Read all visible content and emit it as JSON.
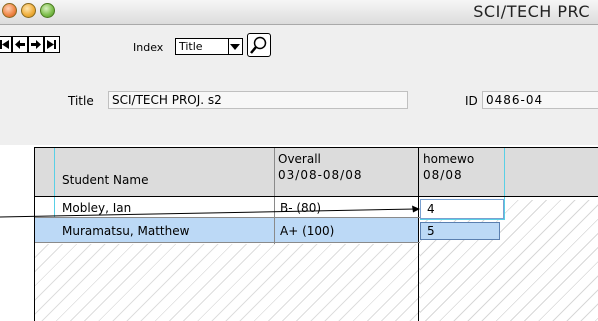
{
  "window": {
    "title": "SCI/TECH PRC"
  },
  "toolbar": {
    "index_label": "Index",
    "index_value": "Title",
    "nav_buttons": [
      "first-record",
      "previous-record",
      "next-record",
      "last-record"
    ]
  },
  "record": {
    "title_label": "Title",
    "title_value": "SCI/TECH PROJ. s2",
    "id_label": "ID",
    "id_value": "0486-04"
  },
  "table": {
    "columns": [
      {
        "line1": "",
        "line2": "Student Name"
      },
      {
        "line1": "Overall",
        "line2": "03/08-08/08"
      },
      {
        "line1": "homewo",
        "line2": "08/08"
      }
    ],
    "rows": [
      {
        "name": "Mobley, Ian",
        "overall": "B- (80)",
        "homework": "4"
      },
      {
        "name": "Muramatsu, Matthew",
        "overall": "A+ (100)",
        "homework": "5"
      }
    ]
  },
  "colors": {
    "selected_row": "#bcd9f6",
    "header_row": "#dcdcdc",
    "grid_cyan": "#59d0e6"
  }
}
